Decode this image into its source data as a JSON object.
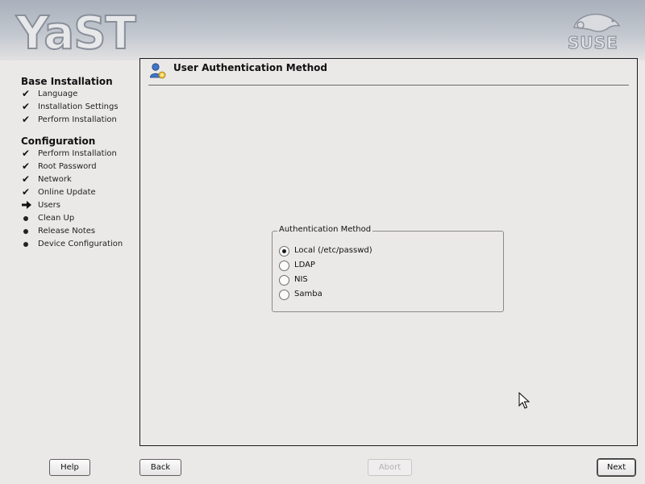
{
  "header": {
    "logo_text": "YaST",
    "brand_text": "SUSE"
  },
  "sidebar": {
    "sections": [
      {
        "title": "Base Installation",
        "steps": [
          {
            "label": "Language",
            "status": "done"
          },
          {
            "label": "Installation Settings",
            "status": "done"
          },
          {
            "label": "Perform Installation",
            "status": "done"
          }
        ]
      },
      {
        "title": "Configuration",
        "steps": [
          {
            "label": "Perform Installation",
            "status": "done"
          },
          {
            "label": "Root Password",
            "status": "done"
          },
          {
            "label": "Network",
            "status": "done"
          },
          {
            "label": "Online Update",
            "status": "done"
          },
          {
            "label": "Users",
            "status": "current"
          },
          {
            "label": "Clean Up",
            "status": "pending"
          },
          {
            "label": "Release Notes",
            "status": "pending"
          },
          {
            "label": "Device Configuration",
            "status": "pending"
          }
        ]
      }
    ]
  },
  "content": {
    "icon": "user-config-icon",
    "title": "User Authentication Method",
    "group": {
      "legend": "Authentication Method",
      "options": [
        {
          "label": "Local (/etc/passwd)",
          "selected": true
        },
        {
          "label": "LDAP",
          "selected": false
        },
        {
          "label": "NIS",
          "selected": false
        },
        {
          "label": "Samba",
          "selected": false
        }
      ]
    }
  },
  "buttons": {
    "help": "Help",
    "back": "Back",
    "abort": "Abort",
    "next": "Next"
  },
  "colors": {
    "background": "#ebe8e8",
    "header_top": "#a9b0bb",
    "frame_border": "#1a1a1a"
  }
}
